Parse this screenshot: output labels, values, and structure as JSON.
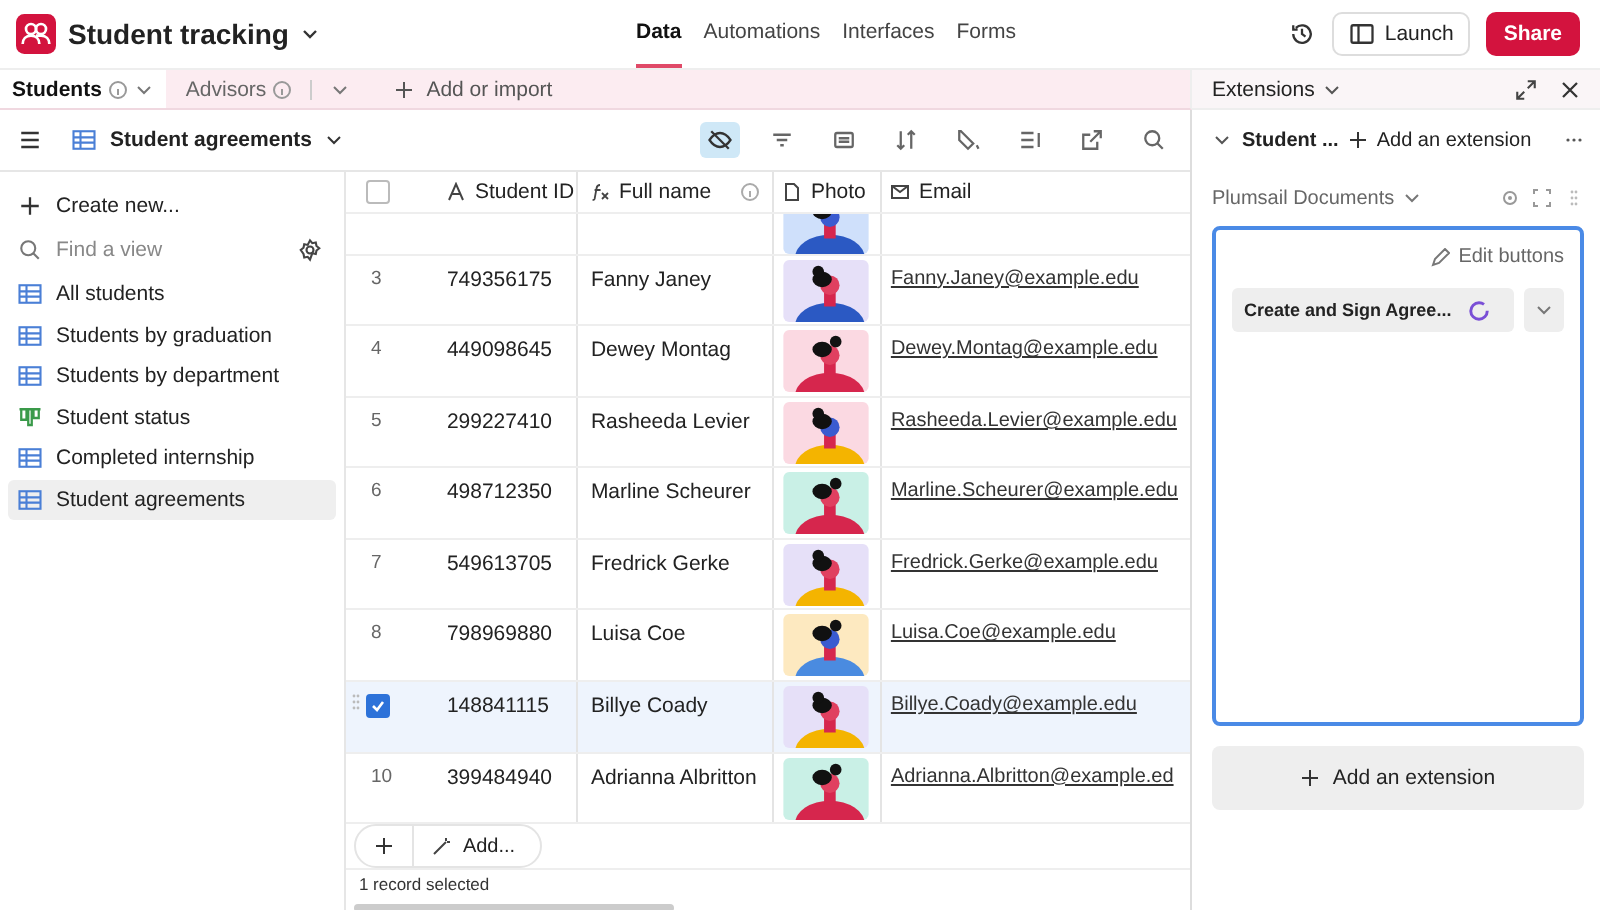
{
  "app": {
    "title": "Student tracking"
  },
  "nav": [
    {
      "label": "Data",
      "selected": true
    },
    {
      "label": "Automations",
      "selected": false
    },
    {
      "label": "Interfaces",
      "selected": false
    },
    {
      "label": "Forms",
      "selected": false
    }
  ],
  "actions": {
    "launch": "Launch",
    "share": "Share"
  },
  "tables": [
    {
      "label": "Students",
      "selected": true
    },
    {
      "label": "Advisors",
      "selected": false
    }
  ],
  "add_table": "Add or import",
  "view": {
    "name": "Student agreements"
  },
  "toolbar": [
    {
      "kind": "hide",
      "selected": true
    },
    {
      "kind": "filter",
      "selected": false
    },
    {
      "kind": "group",
      "selected": false
    },
    {
      "kind": "sort",
      "selected": false
    },
    {
      "kind": "color",
      "selected": false
    },
    {
      "kind": "height",
      "selected": false
    },
    {
      "kind": "share",
      "selected": false
    },
    {
      "kind": "search",
      "selected": false
    }
  ],
  "sidebar": {
    "create": "Create new...",
    "search": {
      "placeholder": "Find a view"
    },
    "items": [
      {
        "label": "All students",
        "kind": "grid",
        "selected": false
      },
      {
        "label": "Students by graduation",
        "kind": "grid",
        "selected": false
      },
      {
        "label": "Students by department",
        "kind": "grid",
        "selected": false
      },
      {
        "label": "Student status",
        "kind": "kanban",
        "selected": false
      },
      {
        "label": "Completed internship",
        "kind": "grid",
        "selected": false
      },
      {
        "label": "Student agreements",
        "kind": "grid",
        "selected": true
      }
    ]
  },
  "table": {
    "all_selected": false,
    "columns": [
      "Student ID",
      "Full name",
      "Photo",
      "Email"
    ],
    "rows": [
      {
        "number": "3",
        "id": "749356175",
        "name": "Fanny Janey",
        "email": "Fanny.Janey@example.edu",
        "selected": false
      },
      {
        "number": "4",
        "id": "449098645",
        "name": "Dewey Montag",
        "email": "Dewey.Montag@example.edu",
        "selected": false
      },
      {
        "number": "5",
        "id": "299227410",
        "name": "Rasheeda Levier",
        "email": "Rasheeda.Levier@example.edu",
        "selected": false
      },
      {
        "number": "6",
        "id": "498712350",
        "name": "Marline Scheurer",
        "email": "Marline.Scheurer@example.edu",
        "selected": false
      },
      {
        "number": "7",
        "id": "549613705",
        "name": "Fredrick Gerke",
        "email": "Fredrick.Gerke@example.edu",
        "selected": false
      },
      {
        "number": "8",
        "id": "798969880",
        "name": "Luisa Coe",
        "email": "Luisa.Coe@example.edu",
        "selected": false
      },
      {
        "id": "148841115",
        "name": "Billye Coady",
        "email": "Billye.Coady@example.edu",
        "selected": true
      },
      {
        "number": "10",
        "id": "399484940",
        "name": "Adrianna Albritton",
        "email": "Adrianna.Albritton@example.ed",
        "selected": false
      }
    ],
    "add": "Add...",
    "status": "1 record selected"
  },
  "extensions": {
    "title": "Extensions",
    "dashboard": "Student ...",
    "add_top": "Add an extension",
    "extension_name": "Plumsail Documents",
    "edit": "Edit buttons",
    "action": "Create and Sign Agree...",
    "add_bottom": "Add an extension"
  }
}
